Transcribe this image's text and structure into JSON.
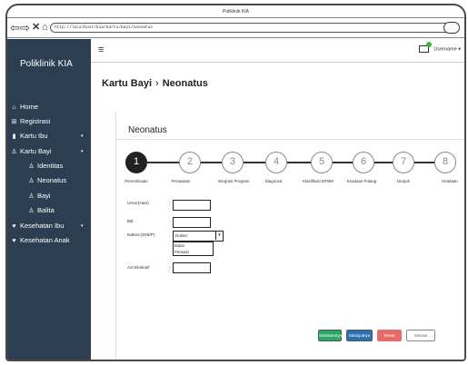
{
  "window": {
    "title": "Poliklinik KIA"
  },
  "browser": {
    "url": "http://localhost/kia/kartu/bayi/neonatus",
    "back_icon": "arrow-left-icon",
    "forward_icon": "arrow-right-icon",
    "stop_icon": "close-icon",
    "home_icon": "home-icon"
  },
  "sidebar": {
    "brand": "Poliklinik KIA",
    "bg_color": "#2c3e51",
    "items": [
      {
        "label": "Home",
        "icon": "home-icon",
        "glyph": "⌂",
        "caret": ""
      },
      {
        "label": "Registrasi",
        "icon": "plus-square-icon",
        "glyph": "⊞",
        "caret": ""
      },
      {
        "label": "Kartu Ibu",
        "icon": "book-icon",
        "glyph": "▮",
        "caret": "▾"
      },
      {
        "label": "Kartu Bayi",
        "icon": "child-icon",
        "glyph": "♙",
        "caret": "▾"
      },
      {
        "label": "Identitas",
        "icon": "child-icon",
        "glyph": "♙",
        "caret": ""
      },
      {
        "label": "Neonatus",
        "icon": "child-icon",
        "glyph": "♙",
        "caret": ""
      },
      {
        "label": "Bayi",
        "icon": "child-icon",
        "glyph": "♙",
        "caret": ""
      },
      {
        "label": "Balita",
        "icon": "child-icon",
        "glyph": "♙",
        "caret": ""
      },
      {
        "label": "Kesehatan Ibu",
        "icon": "heart-icon",
        "glyph": "♥",
        "caret": "▾"
      },
      {
        "label": "Kesehatan Anak",
        "icon": "heart-icon",
        "glyph": "♥",
        "caret": ""
      }
    ]
  },
  "topbar": {
    "menu_icon": "hamburger-icon",
    "mail_icon": "mail-icon",
    "username": "Username ▾",
    "notification_color": "#3cb43c"
  },
  "breadcrumb": {
    "root": "Kartu Bayi",
    "separator": "›",
    "current": "Neonatus"
  },
  "panel": {
    "heading": "Neonatus"
  },
  "stepper": {
    "steps": [
      {
        "number": "1",
        "label": "Pemeriksaan",
        "active": true
      },
      {
        "number": "2",
        "label": "Perawatan",
        "active": false
      },
      {
        "number": "3",
        "label": "Integrasi Program",
        "active": false
      },
      {
        "number": "4",
        "label": "Diagnosa",
        "active": false
      },
      {
        "number": "5",
        "label": "Klasifikasi MTBM",
        "active": false
      },
      {
        "number": "6",
        "label": "Keadaan Pulang",
        "active": false
      },
      {
        "number": "7",
        "label": "Dirujuk",
        "active": false
      },
      {
        "number": "8",
        "label": "Keadaan",
        "active": false
      }
    ]
  },
  "form": {
    "umur_label": "Umur(Hari)",
    "umur_value": "",
    "bb_label": "BB",
    "bb_value": "",
    "nakes_label": "Nakes (D/B/P)",
    "nakes_selected": "Dokter",
    "nakes_options": [
      "Bidan",
      "Perawat"
    ],
    "asi_label": "Asi Ekslusif",
    "asi_value": ""
  },
  "buttons": {
    "prev_label": "Sebelumnya",
    "next_label": "Selanjutnya",
    "reset_label": "Reset",
    "finish_label": "Selesai",
    "prev_color": "#2aa86a",
    "next_color": "#2c6fb3",
    "reset_color": "#e86b6b"
  }
}
